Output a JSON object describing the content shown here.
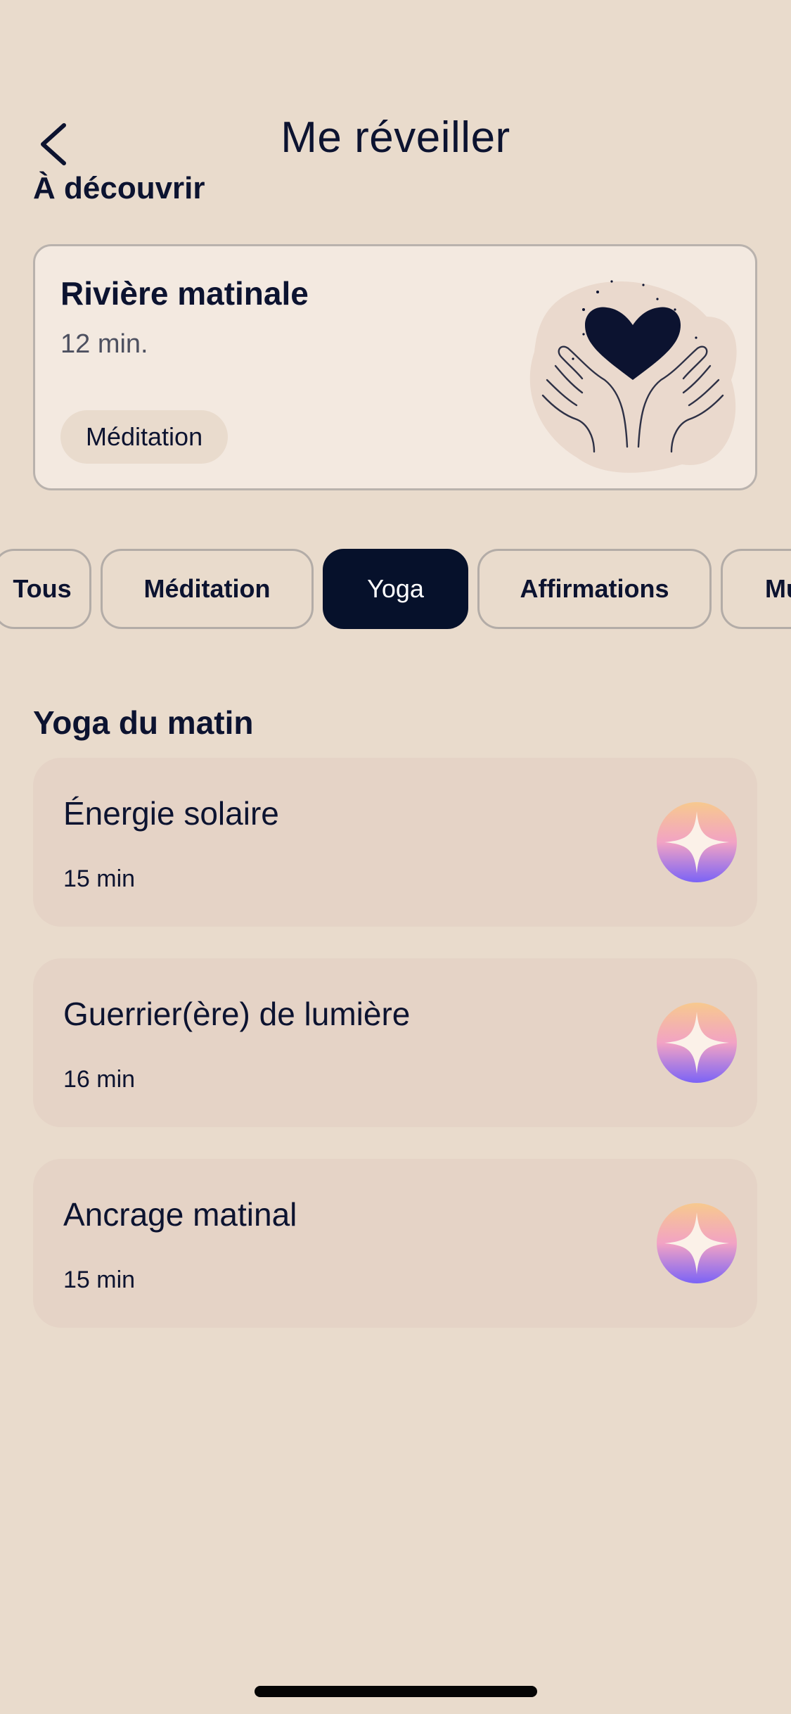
{
  "header": {
    "title": "Me réveiller",
    "back_icon": "chevron-left-icon"
  },
  "discover": {
    "section_title": "À découvrir",
    "featured": {
      "title": "Rivière matinale",
      "duration": "12 min.",
      "tag": "Méditation",
      "illustration": "hands-heart-icon"
    }
  },
  "filters": {
    "tabs": [
      {
        "label": "Tous",
        "active": false
      },
      {
        "label": "Méditation",
        "active": false
      },
      {
        "label": "Yoga",
        "active": true
      },
      {
        "label": "Affirmations",
        "active": false
      },
      {
        "label": "Mu",
        "active": false
      }
    ]
  },
  "yoga": {
    "heading": "Yoga du matin",
    "sessions": [
      {
        "title": "Énergie solaire",
        "duration": "15 min",
        "icon": "sparkle-icon"
      },
      {
        "title": "Guerrier(ère) de lumière",
        "duration": "16 min",
        "icon": "sparkle-icon"
      },
      {
        "title": "Ancrage matinal",
        "duration": "15 min",
        "icon": "sparkle-icon"
      }
    ]
  },
  "colors": {
    "background": "#e9dbcc",
    "text": "#0c1330",
    "active_tab": "#06112b",
    "card": "#e5d3c6",
    "featured_card": "#f3e9e0"
  }
}
